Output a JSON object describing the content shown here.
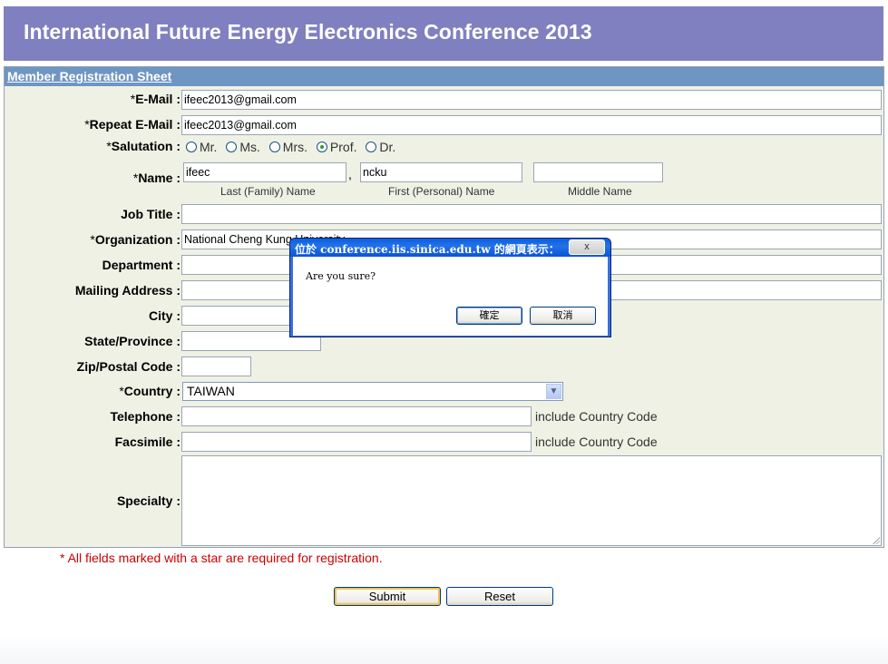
{
  "banner": {
    "title": "International Future Energy Electronics Conference 2013"
  },
  "sheet": {
    "title": "Member Registration Sheet"
  },
  "fields": {
    "email": {
      "label": "E-Mail :",
      "value": "ifeec2013@gmail.com",
      "required": "*"
    },
    "repeat_email": {
      "label": "Repeat E-Mail :",
      "value": "ifeec2013@gmail.com",
      "required": "*"
    },
    "salutation": {
      "label": "Salutation :",
      "required": "*",
      "options": [
        "Mr.",
        "Ms.",
        "Mrs.",
        "Prof.",
        "Dr."
      ],
      "selected": "Prof."
    },
    "name": {
      "label": "Name :",
      "required": "*",
      "last": {
        "value": "ifeec",
        "caption": "Last (Family) Name"
      },
      "separator": ",",
      "first": {
        "value": "ncku",
        "caption": "First (Personal) Name"
      },
      "middle": {
        "value": "",
        "caption": "Middle Name"
      }
    },
    "job_title": {
      "label": "Job Title :",
      "value": ""
    },
    "organization": {
      "label": "Organization :",
      "value": "National Cheng Kung University",
      "required": "*"
    },
    "department": {
      "label": "Department :",
      "value": ""
    },
    "mailing_address": {
      "label": "Mailing Address :",
      "value": ""
    },
    "city": {
      "label": "City :",
      "value": ""
    },
    "state": {
      "label": "State/Province :",
      "value": ""
    },
    "zip": {
      "label": "Zip/Postal Code :",
      "value": ""
    },
    "country": {
      "label": "Country :",
      "value": "TAIWAN",
      "required": "*"
    },
    "telephone": {
      "label": "Telephone :",
      "value": "",
      "hint": "include Country Code"
    },
    "facsimile": {
      "label": "Facsimile :",
      "value": "",
      "hint": "include Country Code"
    },
    "specialty": {
      "label": "Specialty :",
      "value": ""
    }
  },
  "note": "* All fields marked with a star are required for registration.",
  "buttons": {
    "submit": "Submit",
    "reset": "Reset"
  },
  "dialog": {
    "title": "位於 conference.iis.sinica.edu.tw 的網頁表示：",
    "close": "x",
    "message": "Are you sure?",
    "ok": "確定",
    "cancel": "取消"
  },
  "colors": {
    "banner": "#8080c0",
    "sheet_header": "#6f95c2",
    "sheet_bg": "#eef1e4",
    "required_note": "#cc0000",
    "dialog_title": "#0a5fde"
  }
}
